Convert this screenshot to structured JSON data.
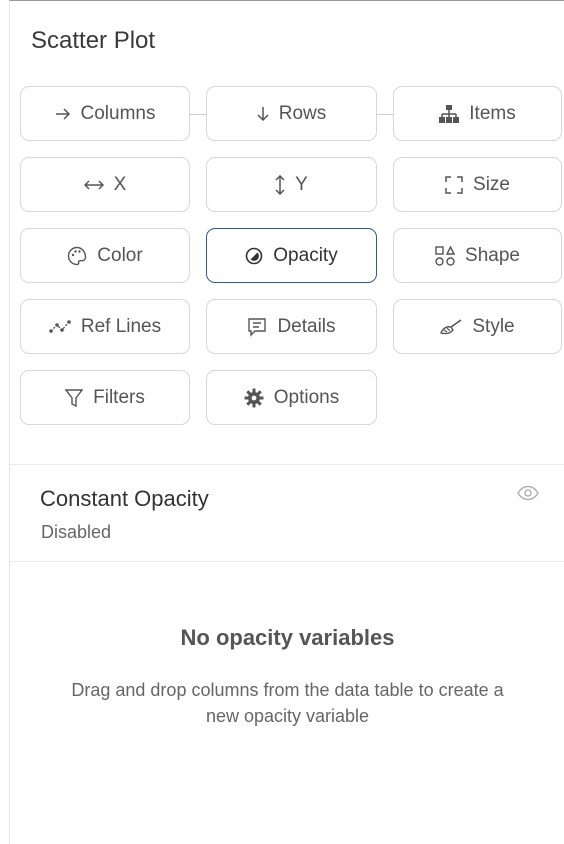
{
  "header": {
    "title": "Scatter Plot"
  },
  "buttons": {
    "columns": "Columns",
    "rows": "Rows",
    "items": "Items",
    "x": "X",
    "y": "Y",
    "size": "Size",
    "color": "Color",
    "opacity": "Opacity",
    "shape": "Shape",
    "ref_lines": "Ref Lines",
    "details": "Details",
    "style": "Style",
    "filters": "Filters",
    "options": "Options"
  },
  "active_button": "opacity",
  "constant_opacity": {
    "title": "Constant Opacity",
    "status": "Disabled"
  },
  "empty_state": {
    "title": "No opacity variables",
    "description": "Drag and drop columns from the data table to create a new opacity variable"
  },
  "colors": {
    "active_border": "#2e5a8e",
    "border": "#d8d8d8"
  }
}
